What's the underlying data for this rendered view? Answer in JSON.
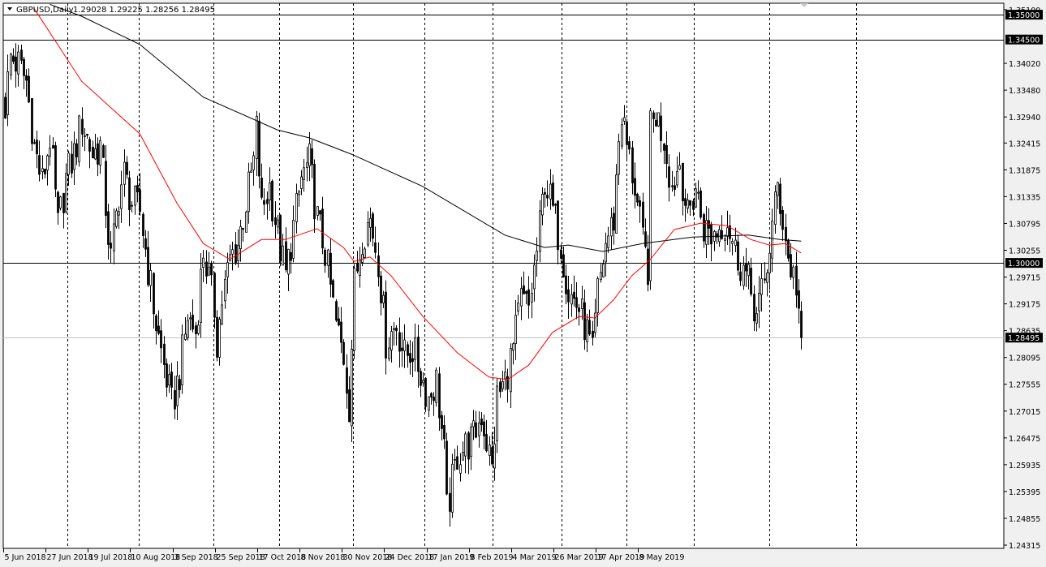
{
  "header": {
    "symbol": "GBPUSD,Daily",
    "ohlc": "1.29028 1.29225 1.28256 1.28495"
  },
  "colors": {
    "background": "#ffffff",
    "candle_up": "#ffffff",
    "candle_down": "#000000",
    "ma_fast": "#ff0000",
    "ma_slow": "#000000",
    "bid_line": "#c0c0c0"
  },
  "chart_data": {
    "type": "candlestick",
    "title": "GBPUSD,Daily",
    "ylim": [
      1.2425,
      1.35296
    ],
    "bars": 302,
    "y_ticks": [
      "1.35100",
      "1.34020",
      "1.33480",
      "1.32940",
      "1.32415",
      "1.31875",
      "1.31335",
      "1.30795",
      "1.30255",
      "1.29715",
      "1.29175",
      "1.28635",
      "1.28095",
      "1.27555",
      "1.27015",
      "1.26475",
      "1.25935",
      "1.25395",
      "1.24855",
      "1.24315"
    ],
    "x_ticks": [
      "5 Jun 2018",
      "27 Jun 2018",
      "19 Jul 2018",
      "10 Aug 2018",
      "3 Sep 2018",
      "25 Sep 2018",
      "17 Oct 2018",
      "8 Nov 2018",
      "30 Nov 2018",
      "24 Dec 2018",
      "17 Jan 2019",
      "8 Feb 2019",
      "4 Mar 2019",
      "26 Mar 2019",
      "17 Apr 2019",
      "8 May 2019"
    ],
    "x_tick_every_bars": 16,
    "horizontal_levels": [
      {
        "price": 1.35,
        "label": "1.35000"
      },
      {
        "price": 1.345,
        "label": "1.34500"
      },
      {
        "price": 1.3,
        "label": "1.30000"
      }
    ],
    "bid": {
      "price": 1.28495,
      "label": "1.28495"
    },
    "last_candle": {
      "open": 1.29028,
      "high": 1.29225,
      "low": 1.28256,
      "close": 1.28495
    },
    "close_anchors": [
      [
        0,
        1.3317
      ],
      [
        2,
        1.3415
      ],
      [
        5,
        1.3399
      ],
      [
        8,
        1.3366
      ],
      [
        11,
        1.3235
      ],
      [
        14,
        1.3162
      ],
      [
        17,
        1.3252
      ],
      [
        20,
        1.3072
      ],
      [
        23,
        1.317
      ],
      [
        26,
        1.3219
      ],
      [
        29,
        1.3285
      ],
      [
        33,
        1.3219
      ],
      [
        36,
        1.3235
      ],
      [
        39,
        1.3056
      ],
      [
        40,
        1.3007
      ],
      [
        43,
        1.3137
      ],
      [
        45,
        1.3178
      ],
      [
        48,
        1.3121
      ],
      [
        51,
        1.3105
      ],
      [
        54,
        1.299
      ],
      [
        57,
        1.2876
      ],
      [
        60,
        1.2794
      ],
      [
        63,
        1.2713
      ],
      [
        66,
        1.2778
      ],
      [
        69,
        1.2892
      ],
      [
        72,
        1.286
      ],
      [
        75,
        1.3023
      ],
      [
        79,
        1.2909
      ],
      [
        80,
        1.2843
      ],
      [
        82,
        1.2925
      ],
      [
        85,
        1.3007
      ],
      [
        88,
        1.3039
      ],
      [
        91,
        1.3121
      ],
      [
        94,
        1.3203
      ],
      [
        95,
        1.3268
      ],
      [
        97,
        1.3105
      ],
      [
        100,
        1.3154
      ],
      [
        103,
        1.3056
      ],
      [
        106,
        1.2974
      ],
      [
        109,
        1.3072
      ],
      [
        112,
        1.317
      ],
      [
        115,
        1.3203
      ],
      [
        118,
        1.3088
      ],
      [
        121,
        1.3023
      ],
      [
        125,
        1.2876
      ],
      [
        128,
        1.2811
      ],
      [
        130,
        1.2713
      ],
      [
        132,
        1.2958
      ],
      [
        135,
        1.3056
      ],
      [
        138,
        1.3088
      ],
      [
        141,
        1.3007
      ],
      [
        144,
        1.2843
      ],
      [
        148,
        1.2876
      ],
      [
        151,
        1.2811
      ],
      [
        154,
        1.2827
      ],
      [
        157,
        1.2778
      ],
      [
        160,
        1.2729
      ],
      [
        163,
        1.2762
      ],
      [
        166,
        1.2614
      ],
      [
        167,
        1.25
      ],
      [
        171,
        1.2614
      ],
      [
        174,
        1.2631
      ],
      [
        177,
        1.2647
      ],
      [
        180,
        1.2696
      ],
      [
        183,
        1.2614
      ],
      [
        184,
        1.2582
      ],
      [
        186,
        1.2729
      ],
      [
        189,
        1.2762
      ],
      [
        192,
        1.2827
      ],
      [
        195,
        1.2925
      ],
      [
        198,
        1.2909
      ],
      [
        201,
        1.3023
      ],
      [
        204,
        1.317
      ],
      [
        207,
        1.3105
      ],
      [
        210,
        1.3039
      ],
      [
        213,
        1.2941
      ],
      [
        217,
        1.2909
      ],
      [
        220,
        1.286
      ],
      [
        222,
        1.2811
      ],
      [
        224,
        1.2941
      ],
      [
        227,
        1.3039
      ],
      [
        230,
        1.3088
      ],
      [
        232,
        1.3252
      ],
      [
        233,
        1.3301
      ],
      [
        235,
        1.3235
      ],
      [
        238,
        1.3154
      ],
      [
        241,
        1.3039
      ],
      [
        243,
        1.299
      ],
      [
        244,
        1.3268
      ],
      [
        246,
        1.3301
      ],
      [
        249,
        1.3252
      ],
      [
        252,
        1.3154
      ],
      [
        255,
        1.3203
      ],
      [
        258,
        1.3088
      ],
      [
        261,
        1.3154
      ],
      [
        264,
        1.3072
      ],
      [
        267,
        1.3056
      ],
      [
        270,
        1.3072
      ],
      [
        273,
        1.3088
      ],
      [
        276,
        1.3023
      ],
      [
        279,
        1.299
      ],
      [
        282,
        1.2941
      ],
      [
        284,
        1.2892
      ],
      [
        287,
        1.2958
      ],
      [
        290,
        1.3072
      ],
      [
        292,
        1.3154
      ],
      [
        294,
        1.3088
      ],
      [
        296,
        1.3007
      ],
      [
        299,
        1.2958
      ],
      [
        301,
        1.28495
      ]
    ],
    "series": [
      {
        "name": "MA slow",
        "color": "#000000",
        "points": [
          [
            17,
            1.3521
          ],
          [
            29,
            1.3497
          ],
          [
            51,
            1.344
          ],
          [
            75,
            1.3334
          ],
          [
            103,
            1.3268
          ],
          [
            115,
            1.3252
          ],
          [
            131,
            1.3219
          ],
          [
            158,
            1.3154
          ],
          [
            189,
            1.3056
          ],
          [
            204,
            1.3031
          ],
          [
            213,
            1.3036
          ],
          [
            226,
            1.3023
          ],
          [
            241,
            1.3039
          ],
          [
            260,
            1.3052
          ],
          [
            281,
            1.3056
          ],
          [
            293,
            1.3047
          ],
          [
            301,
            1.3044
          ]
        ]
      },
      {
        "name": "MA fast",
        "color": "#ff0000",
        "points": [
          [
            11,
            1.3513
          ],
          [
            29,
            1.3366
          ],
          [
            51,
            1.326
          ],
          [
            65,
            1.3121
          ],
          [
            75,
            1.3039
          ],
          [
            85,
            1.3007
          ],
          [
            97,
            1.3047
          ],
          [
            106,
            1.3047
          ],
          [
            118,
            1.3069
          ],
          [
            128,
            1.3031
          ],
          [
            132,
            1.3003
          ],
          [
            138,
            1.3012
          ],
          [
            146,
            1.2974
          ],
          [
            158,
            1.2892
          ],
          [
            171,
            1.2819
          ],
          [
            183,
            1.277
          ],
          [
            190,
            1.2765
          ],
          [
            198,
            1.2794
          ],
          [
            207,
            1.286
          ],
          [
            217,
            1.2892
          ],
          [
            223,
            1.2889
          ],
          [
            230,
            1.2925
          ],
          [
            237,
            1.2974
          ],
          [
            244,
            1.3007
          ],
          [
            253,
            1.3067
          ],
          [
            263,
            1.308
          ],
          [
            273,
            1.3075
          ],
          [
            282,
            1.3047
          ],
          [
            289,
            1.3036
          ],
          [
            295,
            1.3039
          ],
          [
            301,
            1.302
          ]
        ]
      }
    ]
  }
}
